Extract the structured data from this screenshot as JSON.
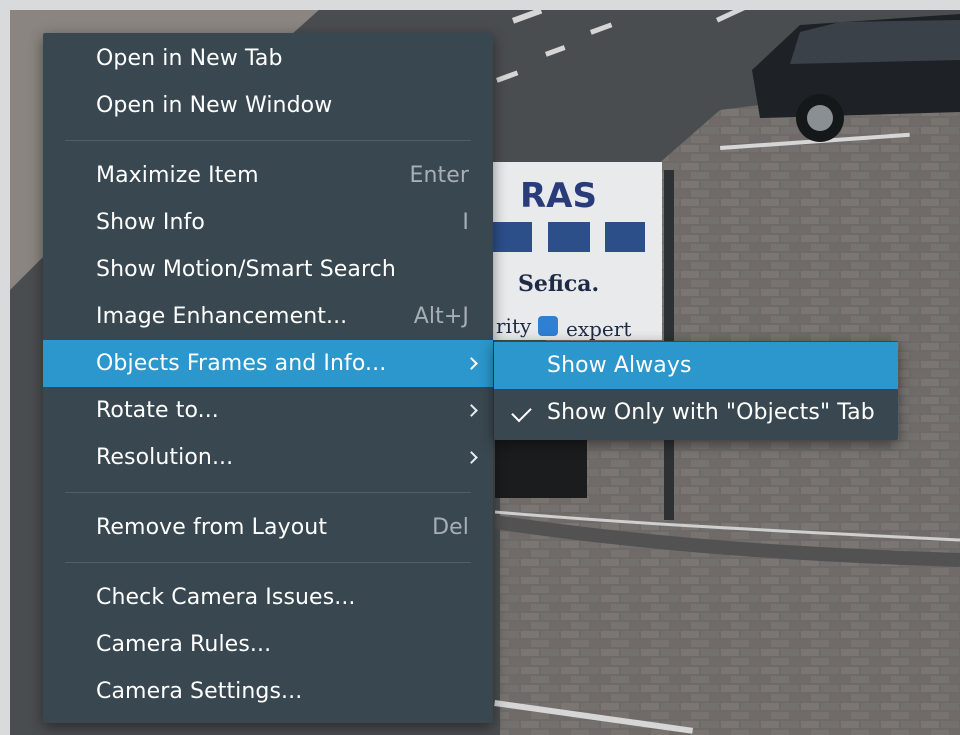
{
  "context_menu": {
    "items": [
      {
        "label": "Open in New Tab"
      },
      {
        "label": "Open in New Window"
      },
      {
        "label": "Maximize Item",
        "shortcut": "Enter"
      },
      {
        "label": "Show Info",
        "shortcut": "I"
      },
      {
        "label": "Show Motion/Smart Search"
      },
      {
        "label": "Image Enhancement...",
        "shortcut": "Alt+J"
      },
      {
        "label": "Objects Frames and Info...",
        "submenu": true,
        "highlighted": true
      },
      {
        "label": "Rotate to...",
        "submenu": true
      },
      {
        "label": "Resolution...",
        "submenu": true
      },
      {
        "label": "Remove from Layout",
        "shortcut": "Del"
      },
      {
        "label": "Check Camera Issues..."
      },
      {
        "label": "Camera Rules..."
      },
      {
        "label": "Camera Settings..."
      }
    ]
  },
  "submenu": {
    "items": [
      {
        "label": "Show Always",
        "highlighted": true,
        "checked": false
      },
      {
        "label": "Show Only with \"Objects\" Tab",
        "checked": true
      }
    ]
  },
  "camera_view": {
    "sign_texts": [
      "RAS",
      "Sefica.",
      "rity",
      "expert"
    ]
  },
  "colors": {
    "menu_bg": "#394850",
    "highlight": "#2b97cc",
    "shortcut_text": "#a3b0b6"
  }
}
